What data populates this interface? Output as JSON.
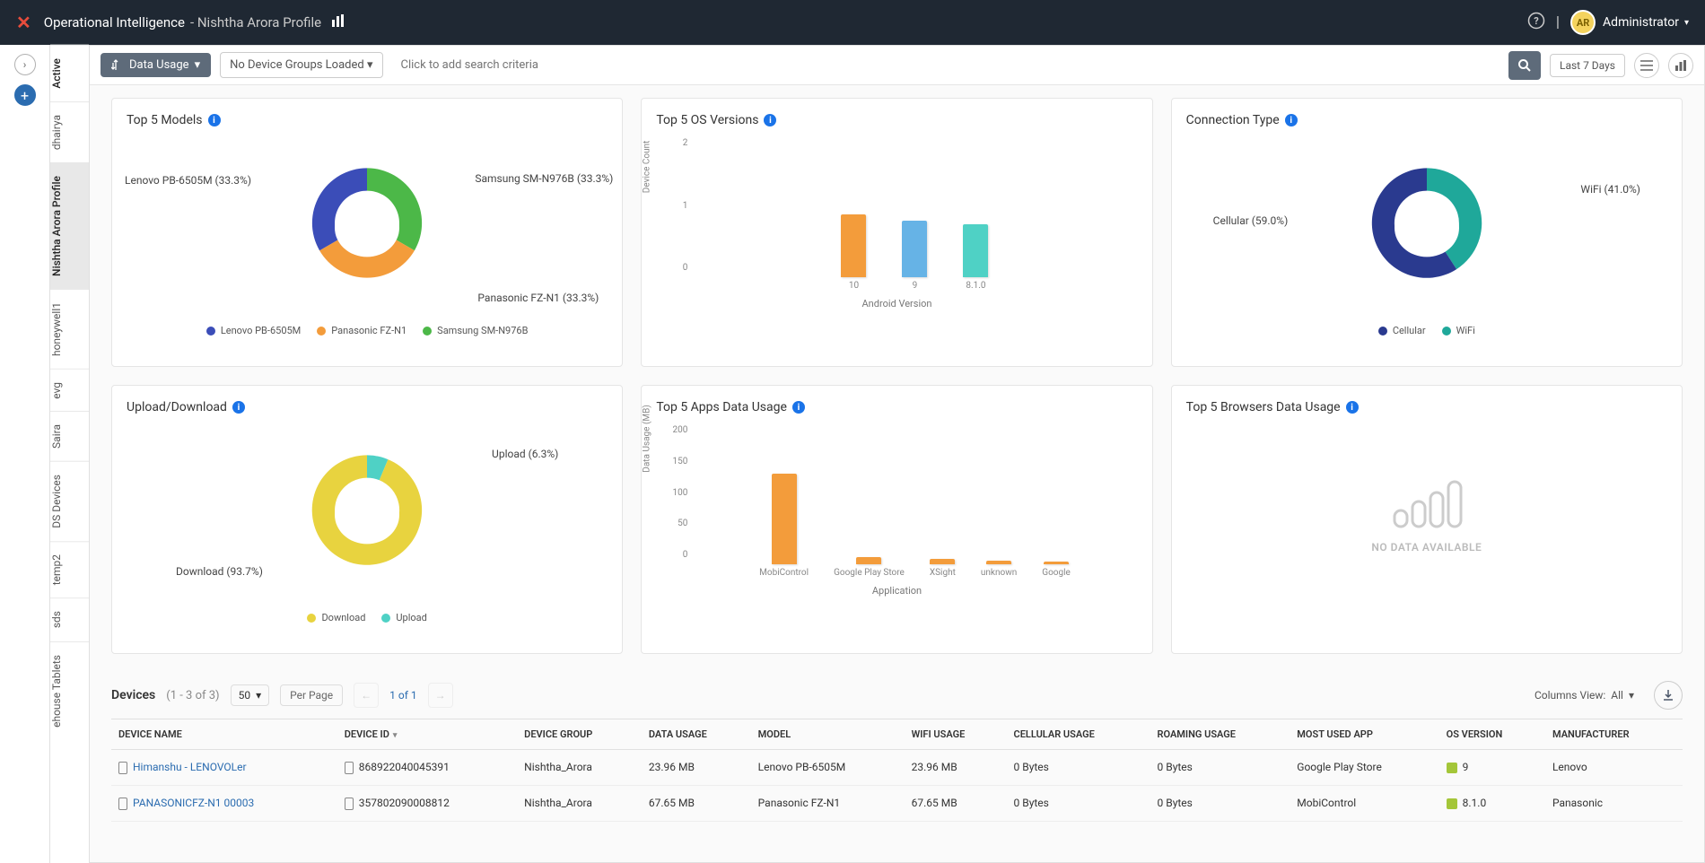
{
  "topbar": {
    "app_name": "Operational Intelligence",
    "separator": " - ",
    "profile": "Nishtha Arora Profile",
    "user": "Administrator",
    "avatar_initials": "AR"
  },
  "toolbar": {
    "data_usage_label": "Data Usage",
    "device_groups_label": "No Device Groups Loaded",
    "search_placeholder": "Click to add search criteria",
    "time_range": "Last 7 Days"
  },
  "tabs": [
    {
      "label": "Active",
      "state": "active"
    },
    {
      "label": "dhairya"
    },
    {
      "label": "Nishtha Arora Profile",
      "state": "current"
    },
    {
      "label": "honeywell1"
    },
    {
      "label": "evg"
    },
    {
      "label": "Saira"
    },
    {
      "label": "DS Devices"
    },
    {
      "label": "temp2"
    },
    {
      "label": "sds"
    },
    {
      "label": "ehouse Tablets"
    }
  ],
  "cards": {
    "top_models": {
      "title": "Top 5 Models"
    },
    "top_os": {
      "title": "Top 5 OS Versions"
    },
    "conn_type": {
      "title": "Connection Type"
    },
    "upload_download": {
      "title": "Upload/Download"
    },
    "top_apps": {
      "title": "Top 5 Apps Data Usage"
    },
    "top_browsers": {
      "title": "Top 5 Browsers Data Usage"
    }
  },
  "chart_data": [
    {
      "id": "top_models",
      "type": "pie",
      "title": "Top 5 Models",
      "series": [
        {
          "name": "Lenovo PB-6505M",
          "value": 33.3,
          "color": "#3b4db8",
          "label": "Lenovo PB-6505M (33.3%)"
        },
        {
          "name": "Panasonic FZ-N1",
          "value": 33.3,
          "color": "#f39c3b",
          "label": "Panasonic FZ-N1 (33.3%)"
        },
        {
          "name": "Samsung SM-N976B",
          "value": 33.3,
          "color": "#4cb848",
          "label": "Samsung SM-N976B (33.3%)"
        }
      ],
      "legend": [
        "Lenovo PB-6505M",
        "Panasonic FZ-N1",
        "Samsung SM-N976B"
      ]
    },
    {
      "id": "top_os",
      "type": "bar",
      "title": "Top 5 OS Versions",
      "xlabel": "Android Version",
      "ylabel": "Device Count",
      "ylim": [
        0,
        2
      ],
      "yticks": [
        0,
        1,
        2
      ],
      "categories": [
        "10",
        "9",
        "8.1.0"
      ],
      "values": [
        1.0,
        0.9,
        0.85
      ],
      "colors": [
        "#f39c3b",
        "#66b3e6",
        "#4fd1c5"
      ]
    },
    {
      "id": "conn_type",
      "type": "pie",
      "title": "Connection Type",
      "series": [
        {
          "name": "Cellular",
          "value": 59.0,
          "color": "#2a3a8f",
          "label": "Cellular (59.0%)"
        },
        {
          "name": "WiFi",
          "value": 41.0,
          "color": "#1fa89a",
          "label": "WiFi (41.0%)"
        }
      ],
      "legend": [
        "Cellular",
        "WiFi"
      ]
    },
    {
      "id": "upload_download",
      "type": "pie",
      "title": "Upload/Download",
      "series": [
        {
          "name": "Download",
          "value": 93.7,
          "color": "#e8d33f",
          "label": "Download (93.7%)"
        },
        {
          "name": "Upload",
          "value": 6.3,
          "color": "#4fd1c5",
          "label": "Upload (6.3%)"
        }
      ],
      "legend": [
        "Download",
        "Upload"
      ]
    },
    {
      "id": "top_apps",
      "type": "bar",
      "title": "Top 5 Apps Data Usage",
      "xlabel": "Application",
      "ylabel": "Data Usage (MB)",
      "ylim": [
        0,
        200
      ],
      "yticks": [
        0,
        50,
        100,
        150,
        200
      ],
      "categories": [
        "MobiControl",
        "Google Play Store",
        "XSight",
        "unknown",
        "Google"
      ],
      "values": [
        145,
        12,
        8,
        6,
        5
      ],
      "colors": [
        "#f39c3b",
        "#f39c3b",
        "#f39c3b",
        "#f39c3b",
        "#f39c3b"
      ]
    },
    {
      "id": "top_browsers",
      "type": "bar",
      "title": "Top 5 Browsers Data Usage",
      "nodata": true,
      "nodata_text": "NO DATA AVAILABLE"
    }
  ],
  "table": {
    "title": "Devices",
    "count_text": "(1 - 3 of 3)",
    "per_page": "50",
    "per_page_label": "Per Page",
    "page_text": "1 of 1",
    "columns_view_label": "Columns View:",
    "columns_view_value": "All",
    "columns": [
      "DEVICE NAME",
      "DEVICE ID",
      "DEVICE GROUP",
      "DATA USAGE",
      "MODEL",
      "WIFI USAGE",
      "CELLULAR USAGE",
      "ROAMING USAGE",
      "MOST USED APP",
      "OS VERSION",
      "MANUFACTURER"
    ],
    "rows": [
      {
        "device_name": "Himanshu - LENOVOLer",
        "device_id": "868922040045391",
        "device_group": "Nishtha_Arora",
        "data_usage": "23.96 MB",
        "model": "Lenovo PB-6505M",
        "wifi_usage": "23.96 MB",
        "cellular_usage": "0 Bytes",
        "roaming_usage": "0 Bytes",
        "most_used_app": "Google Play Store",
        "os_version": "9",
        "manufacturer": "Lenovo"
      },
      {
        "device_name": "PANASONICFZ-N1 00003",
        "device_id": "357802090008812",
        "device_group": "Nishtha_Arora",
        "data_usage": "67.65 MB",
        "model": "Panasonic FZ-N1",
        "wifi_usage": "67.65 MB",
        "cellular_usage": "0 Bytes",
        "roaming_usage": "0 Bytes",
        "most_used_app": "MobiControl",
        "os_version": "8.1.0",
        "manufacturer": "Panasonic"
      }
    ]
  }
}
